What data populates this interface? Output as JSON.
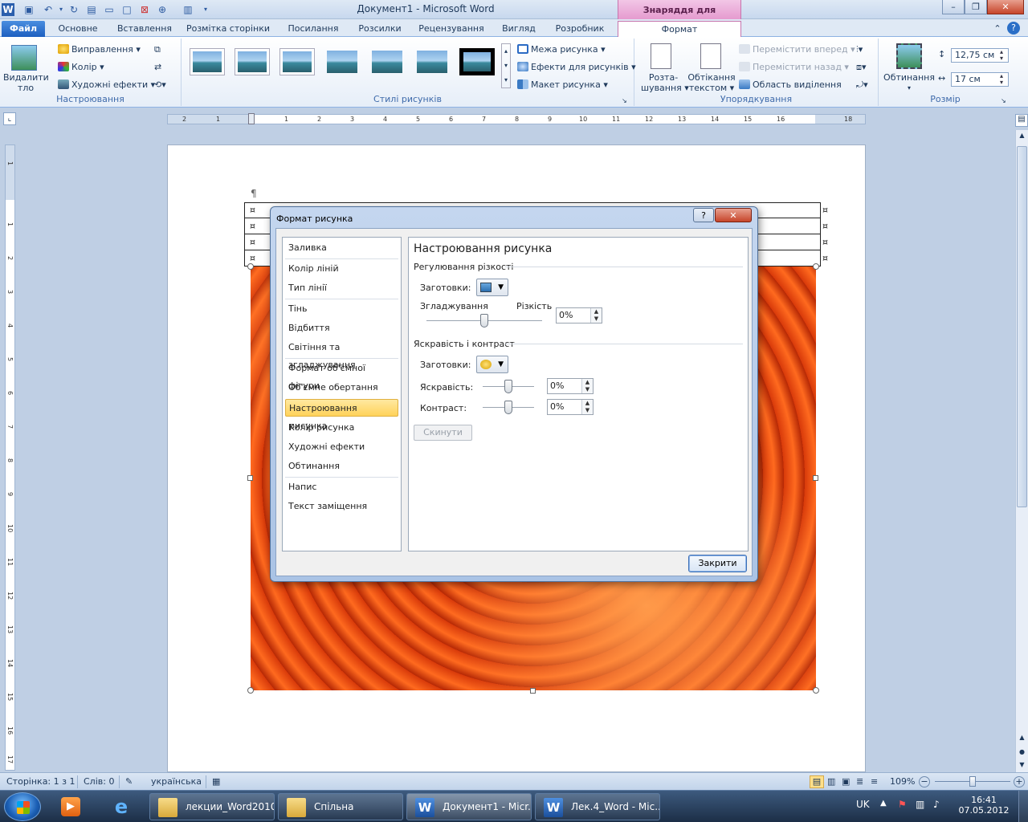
{
  "window": {
    "title": "Документ1  -  Microsoft Word",
    "contextual_tab_header": "Знаряддя для зображення",
    "controls": {
      "minimize": "–",
      "restore": "❐",
      "close": "✕"
    }
  },
  "tabs": [
    "Файл",
    "Основне",
    "Вставлення",
    "Розмітка сторінки",
    "Посилання",
    "Розсилки",
    "Рецензування",
    "Вигляд",
    "Розробник",
    "Формат"
  ],
  "ribbon": {
    "adjust": {
      "remove_bg": [
        "Видалити",
        "тло"
      ],
      "corrections": "Виправлення",
      "color": "Колір",
      "artistic": "Художні ефекти",
      "label": "Настроювання"
    },
    "styles": {
      "label": "Стилі рисунків",
      "border": "Межа рисунка",
      "effects": "Ефекти для рисунків",
      "layout": "Макет рисунка"
    },
    "arrange": {
      "position": [
        "Розта-",
        "шування"
      ],
      "wrap": [
        "Обтікання",
        "текстом"
      ],
      "forward": "Перемістити вперед",
      "backward": "Перемістити назад",
      "selection_pane": "Область виділення",
      "label": "Упорядкування"
    },
    "size": {
      "crop": "Обтинання",
      "height": "12,75 см",
      "width": "17 см",
      "label": "Розмір"
    }
  },
  "ruler": {
    "numbers": [
      "2",
      "1",
      "1",
      "2",
      "3",
      "4",
      "5",
      "6",
      "7",
      "8",
      "9",
      "10",
      "11",
      "12",
      "13",
      "14",
      "15",
      "16",
      "18"
    ]
  },
  "vruler": {
    "numbers": [
      "1",
      "1",
      "2",
      "3",
      "4",
      "5",
      "6",
      "7",
      "8",
      "9",
      "10",
      "11",
      "12",
      "13",
      "14",
      "15",
      "16",
      "17"
    ]
  },
  "document": {
    "pilcrow": "¶",
    "cell_mark": "¤"
  },
  "dialog": {
    "title": "Формат рисунка",
    "help": "?",
    "close_x": "✕",
    "categories": [
      "Заливка",
      "Колір ліній",
      "Тип лінії",
      "Тінь",
      "Відбиття",
      "Світіння та згладжування",
      "Формат об'ємної фігури",
      "Об'ємне обертання",
      "Настроювання рисунка",
      "Колір рисунка",
      "Художні ефекти",
      "Обтинання",
      "Напис",
      "Текст заміщення"
    ],
    "selected_category": "Настроювання рисунка",
    "panel": {
      "title": "Настроювання рисунка",
      "sharpness_section": "Регулювання різкості",
      "presets_label": "Заготовки:",
      "soften_label": "Згладжування",
      "sharpen_label": "Різкість",
      "sharpness_value": "0%",
      "sharpness_slider": 0.5,
      "brightness_section": "Яскравість і контраст",
      "presets_label2": "Заготовки:",
      "brightness_label": "Яскравість:",
      "brightness_value": "0%",
      "brightness_slider": 0.5,
      "contrast_label": "Контраст:",
      "contrast_value": "0%",
      "contrast_slider": 0.5,
      "reset": "Скинути"
    },
    "close_button": "Закрити"
  },
  "statusbar": {
    "page": "Сторінка: 1 з 1",
    "words": "Слів: 0",
    "language": "українська",
    "zoom": "109%",
    "zoom_minus": "−",
    "zoom_plus": "+"
  },
  "taskbar": {
    "tasks": [
      "лекции_Word2010",
      "Спільна",
      "Документ1 - Micr...",
      "Лек.4_Word - Mic..."
    ],
    "lang": "UK",
    "time": "16:41",
    "date": "07.05.2012"
  }
}
